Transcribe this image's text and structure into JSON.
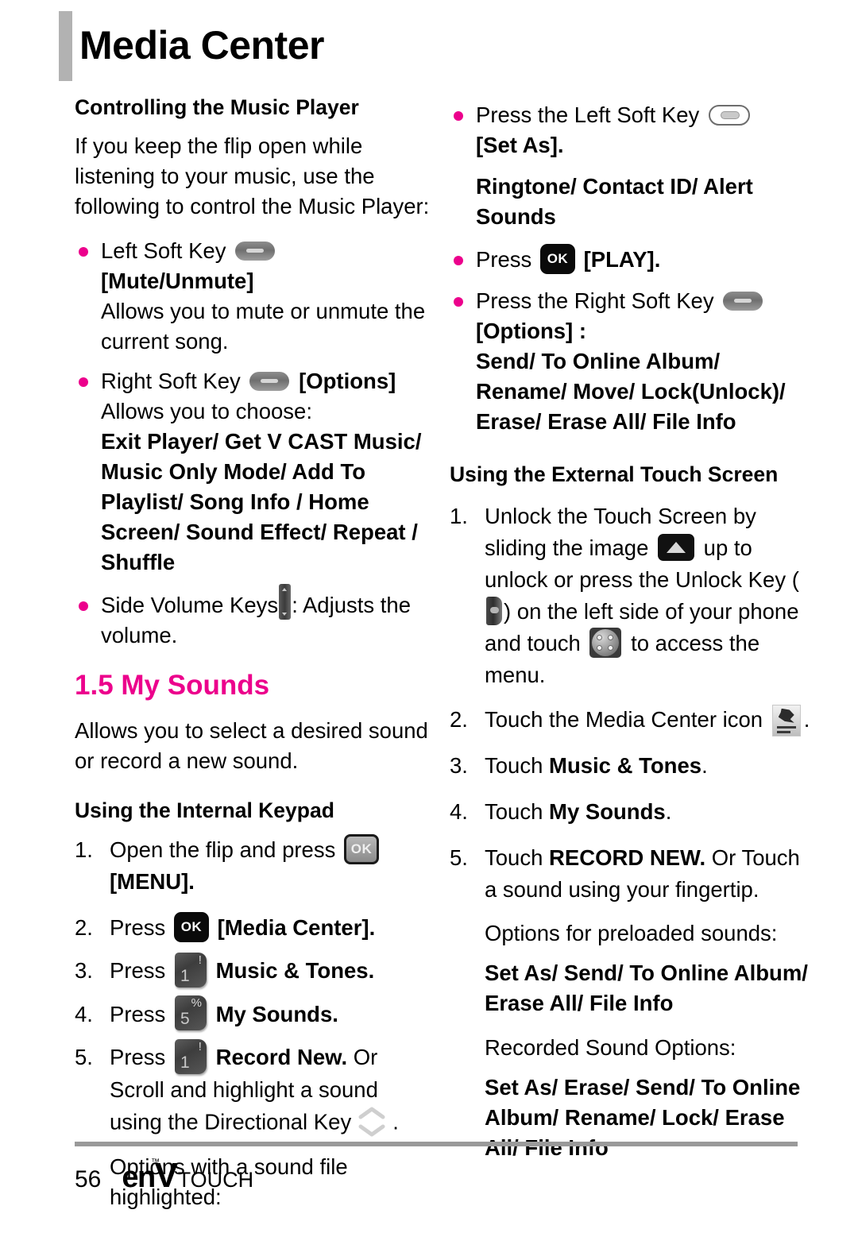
{
  "header": {
    "title": "Media Center"
  },
  "left_column": {
    "heading_controlling": "Controlling the Music Player",
    "intro": "If you keep the flip open while listening to your music, use the following to control the Music Player:",
    "bullets": [
      {
        "label_before": "Left Soft Key",
        "icon": "soft-key-gray-icon",
        "label_after": "[Mute/Unmute]",
        "detail": "Allows you to mute or unmute the current song."
      },
      {
        "label_before": "Right Soft Key",
        "icon": "soft-key-gray-icon",
        "label_after": "[Options]",
        "detail": "Allows you to choose:",
        "options_bold": "Exit Player/ Get V CAST Music/ Music Only Mode/ Add To Playlist/ Song Info / Home Screen/ Sound Effect/ Repeat / Shuffle"
      },
      {
        "label_before": "Side Volume Keys",
        "icon": "side-volume-key-icon",
        "label_after": ": Adjusts the volume."
      }
    ],
    "section_heading": "1.5 My Sounds",
    "section_intro": "Allows you to select a desired sound or record a new sound.",
    "heading_internal_keypad": "Using the Internal Keypad",
    "steps": [
      {
        "num": "1.",
        "text_before": "Open the flip and press",
        "icon": "ok-key-gray-icon",
        "text_after": "[MENU].",
        "after_bold": true
      },
      {
        "num": "2.",
        "text_before": "Press",
        "icon": "ok-key-black-icon",
        "text_after": "[Media Center].",
        "after_bold": true
      },
      {
        "num": "3.",
        "text_before": "Press",
        "icon": "numkey-1-icon",
        "text_after": "Music & Tones.",
        "after_bold": true
      },
      {
        "num": "4.",
        "text_before": "Press",
        "icon": "numkey-5-icon",
        "text_after": "My Sounds.",
        "after_bold": true
      },
      {
        "num": "5.",
        "text_before": "Press",
        "icon": "numkey-1-icon",
        "text_after": "Record New.",
        "text_tail": "Or Scroll and highlight a sound using the Directional Key",
        "dir_icon": "directional-key-icon",
        "text_end": "."
      }
    ],
    "options_note": "Options with a sound file highlighted:"
  },
  "right_column": {
    "bullets": [
      {
        "label_before": "Press the Left Soft Key",
        "icon": "soft-key-outline-icon",
        "label_after": "[Set As].",
        "sub_bold": "Ringtone/ Contact ID/ Alert Sounds"
      },
      {
        "label_before": "Press",
        "icon": "ok-key-black-icon",
        "label_after": "[PLAY]."
      },
      {
        "label_before": "Press the Right Soft Key",
        "icon": "soft-key-gray-icon",
        "label_after": "[Options] :",
        "sub_bold": "Send/ To Online Album/ Rename/ Move/ Lock(Unlock)/ Erase/ Erase All/ File Info"
      }
    ],
    "heading_external_touch": "Using the External Touch Screen",
    "steps": [
      {
        "num": "1.",
        "part1": "Unlock the Touch Screen by sliding the image",
        "icon1": "slide-up-icon",
        "part2": "up to unlock or press the Unlock Key (",
        "icon2": "unlock-key-icon",
        "part3": ") on the left side of your phone and touch",
        "icon3": "menu-dots-icon",
        "part4": "to access the menu."
      },
      {
        "num": "2.",
        "part1": "Touch the Media Center icon",
        "icon1": "media-center-thumbnail-icon",
        "part2": "."
      },
      {
        "num": "3.",
        "part1": "Touch",
        "bold": "Music & Tones",
        "part2": "."
      },
      {
        "num": "4.",
        "part1": "Touch",
        "bold": "My Sounds",
        "part2": "."
      },
      {
        "num": "5.",
        "part1": "Touch",
        "bold": "RECORD NEW.",
        "part2": "Or Touch a sound using your fingertip."
      }
    ],
    "preloaded_label": "Options for preloaded sounds:",
    "preloaded_options": "Set As/ Send/ To Online Album/ Erase All/ File Info",
    "recorded_label": "Recorded Sound Options:",
    "recorded_options": "Set As/ Erase/ Send/ To Online Album/ Rename/ Lock/ Erase All/ File Info"
  },
  "footer": {
    "page_number": "56",
    "logo_env": "enV",
    "logo_touch": "TOUCH",
    "logo_tm": "™"
  },
  "colors": {
    "accent": "#ec008c",
    "header_bar": "#b2b2b2",
    "footer_rule": "#9a9a9a"
  }
}
